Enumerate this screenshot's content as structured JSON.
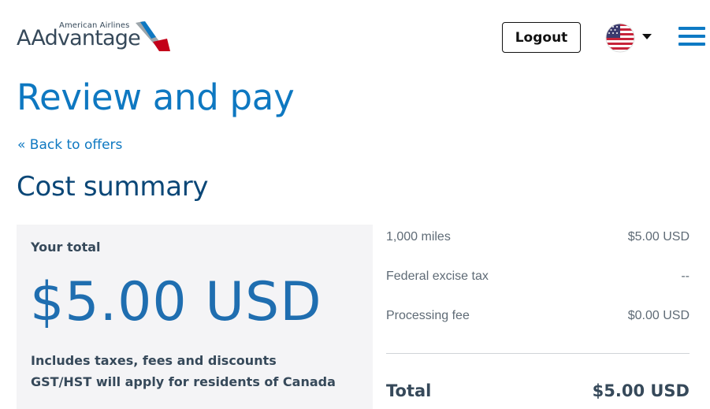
{
  "header": {
    "logo_top": "American Airlines",
    "logo_main": "AAdvantage",
    "logout_label": "Logout",
    "language_icon": "us-flag-icon",
    "menu_icon": "hamburger-menu-icon"
  },
  "page": {
    "title": "Review and pay",
    "back_link": "« Back to offers",
    "section_title": "Cost summary"
  },
  "total_box": {
    "label": "Your total",
    "amount": "$5.00 USD",
    "note_1": "Includes taxes, fees and discounts",
    "note_2": "GST/HST will apply for residents of Canada"
  },
  "breakdown": {
    "rows": [
      {
        "label": "1,000 miles",
        "value": "$5.00 USD"
      },
      {
        "label": "Federal excise tax",
        "value": "--"
      },
      {
        "label": "Processing fee",
        "value": "$0.00 USD"
      }
    ],
    "total_label": "Total",
    "total_value": "$5.00 USD"
  },
  "colors": {
    "brand_blue": "#0e78c1",
    "dark_text": "#36495a",
    "box_bg": "#f4f4f6"
  }
}
